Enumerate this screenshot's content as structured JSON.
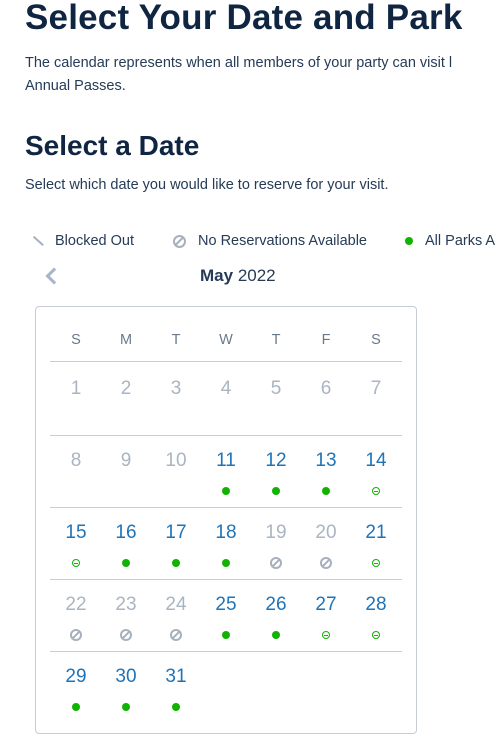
{
  "page": {
    "title": "Select Your Date and Park",
    "intro_line1": "The calendar represents when all members of your party can visit l",
    "intro_line2": "Annual Passes."
  },
  "section": {
    "title": "Select a Date",
    "subtitle": "Select which date you would like to reserve for your visit."
  },
  "legend": {
    "blocked_out": "Blocked Out",
    "no_reservations": "No Reservations Available",
    "all_parks": "All Parks A"
  },
  "calendar": {
    "month": "May",
    "year": "2022",
    "weekdays": [
      "S",
      "M",
      "T",
      "W",
      "T",
      "F",
      "S"
    ],
    "colors": {
      "available": "#1f73b7",
      "unavailable": "#a9b5c2",
      "all_parks": "#11b300",
      "none": "#a7b1bd"
    },
    "weeks": [
      [
        {
          "day": "1",
          "status": "past",
          "marker": ""
        },
        {
          "day": "2",
          "status": "past",
          "marker": ""
        },
        {
          "day": "3",
          "status": "past",
          "marker": ""
        },
        {
          "day": "4",
          "status": "past",
          "marker": ""
        },
        {
          "day": "5",
          "status": "past",
          "marker": ""
        },
        {
          "day": "6",
          "status": "past",
          "marker": ""
        },
        {
          "day": "7",
          "status": "past",
          "marker": ""
        }
      ],
      [
        {
          "day": "8",
          "status": "past",
          "marker": ""
        },
        {
          "day": "9",
          "status": "past",
          "marker": ""
        },
        {
          "day": "10",
          "status": "past",
          "marker": ""
        },
        {
          "day": "11",
          "status": "available",
          "marker": "all-parks"
        },
        {
          "day": "12",
          "status": "available",
          "marker": "all-parks"
        },
        {
          "day": "13",
          "status": "available",
          "marker": "all-parks"
        },
        {
          "day": "14",
          "status": "available",
          "marker": "partial"
        }
      ],
      [
        {
          "day": "15",
          "status": "available",
          "marker": "partial"
        },
        {
          "day": "16",
          "status": "available",
          "marker": "all-parks"
        },
        {
          "day": "17",
          "status": "available",
          "marker": "all-parks"
        },
        {
          "day": "18",
          "status": "available",
          "marker": "all-parks"
        },
        {
          "day": "19",
          "status": "unavailable",
          "marker": "none"
        },
        {
          "day": "20",
          "status": "unavailable",
          "marker": "none"
        },
        {
          "day": "21",
          "status": "available",
          "marker": "partial"
        }
      ],
      [
        {
          "day": "22",
          "status": "unavailable",
          "marker": "none"
        },
        {
          "day": "23",
          "status": "unavailable",
          "marker": "none"
        },
        {
          "day": "24",
          "status": "unavailable",
          "marker": "none"
        },
        {
          "day": "25",
          "status": "available",
          "marker": "all-parks"
        },
        {
          "day": "26",
          "status": "available",
          "marker": "all-parks"
        },
        {
          "day": "27",
          "status": "available",
          "marker": "partial"
        },
        {
          "day": "28",
          "status": "available",
          "marker": "partial"
        }
      ],
      [
        {
          "day": "29",
          "status": "available",
          "marker": "all-parks"
        },
        {
          "day": "30",
          "status": "available",
          "marker": "all-parks"
        },
        {
          "day": "31",
          "status": "available",
          "marker": "all-parks"
        }
      ]
    ]
  }
}
